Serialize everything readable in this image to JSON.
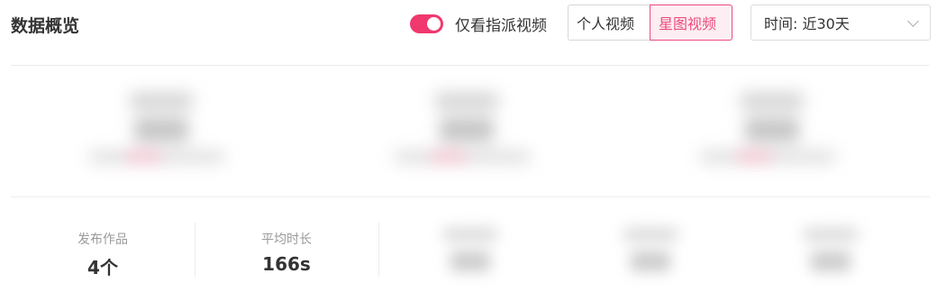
{
  "header": {
    "title": "数据概览",
    "toggle": {
      "label": "仅看指派视频",
      "checked": true,
      "accent_color": "#f0386e"
    },
    "segmented": {
      "options": [
        "个人视频",
        "星图视频"
      ],
      "selected": "星图视频",
      "selected_color": "#ec4c7e"
    },
    "time_select": {
      "value": "时间: 近30天",
      "icon": "chevron-down-icon"
    }
  },
  "stats": [
    {
      "label": "发布作品",
      "value": "4个"
    },
    {
      "label": "平均时长",
      "value": "166s"
    }
  ]
}
